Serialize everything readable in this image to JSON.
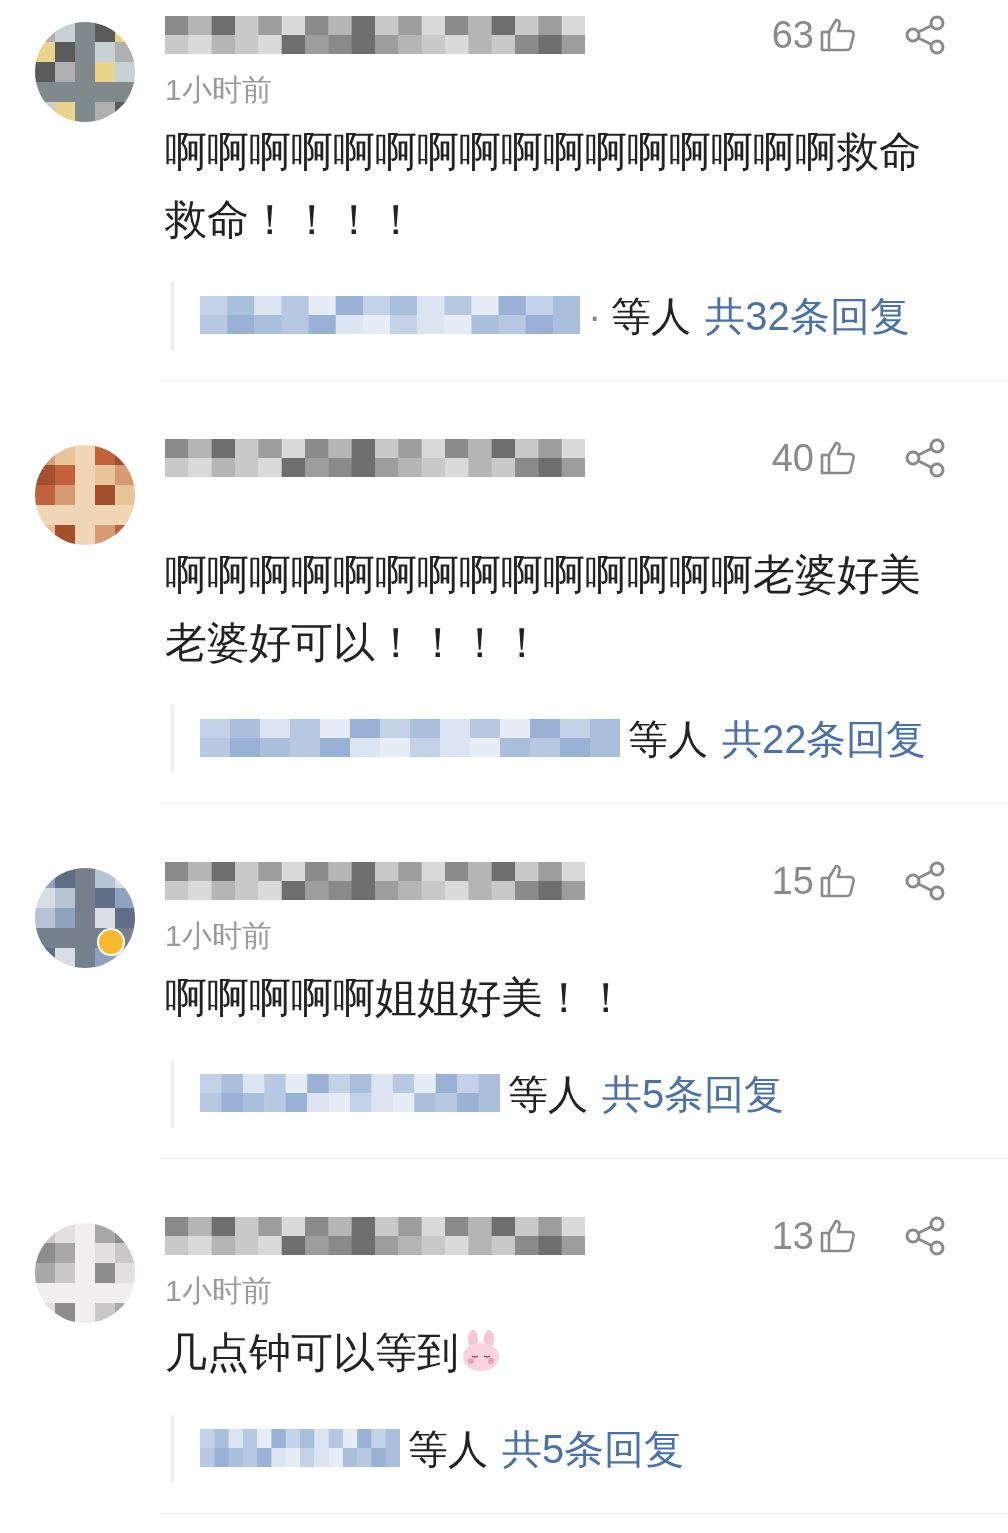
{
  "comments": [
    {
      "likes": "63",
      "time": "1小时前",
      "verified": false,
      "text": "啊啊啊啊啊啊啊啊啊啊啊啊啊啊啊啊救命救命！！！！",
      "replies": {
        "sep": "·",
        "who": "等人",
        "count": "共32条回复"
      }
    },
    {
      "likes": "40",
      "verified": false,
      "text": "啊啊啊啊啊啊啊啊啊啊啊啊啊啊老婆好美老婆好可以！！！！",
      "replies": {
        "who": "等人",
        "count": "共22条回复"
      }
    },
    {
      "likes": "15",
      "time": "1小时前",
      "verified": true,
      "text": "啊啊啊啊啊姐姐好美！！",
      "replies": {
        "who": "等人",
        "count": "共5条回复"
      }
    },
    {
      "likes": "13",
      "time": "1小时前",
      "verified": false,
      "text": "几点钟可以等到",
      "emoji": true,
      "replies": {
        "who": "等人",
        "count": "共5条回复"
      }
    }
  ]
}
